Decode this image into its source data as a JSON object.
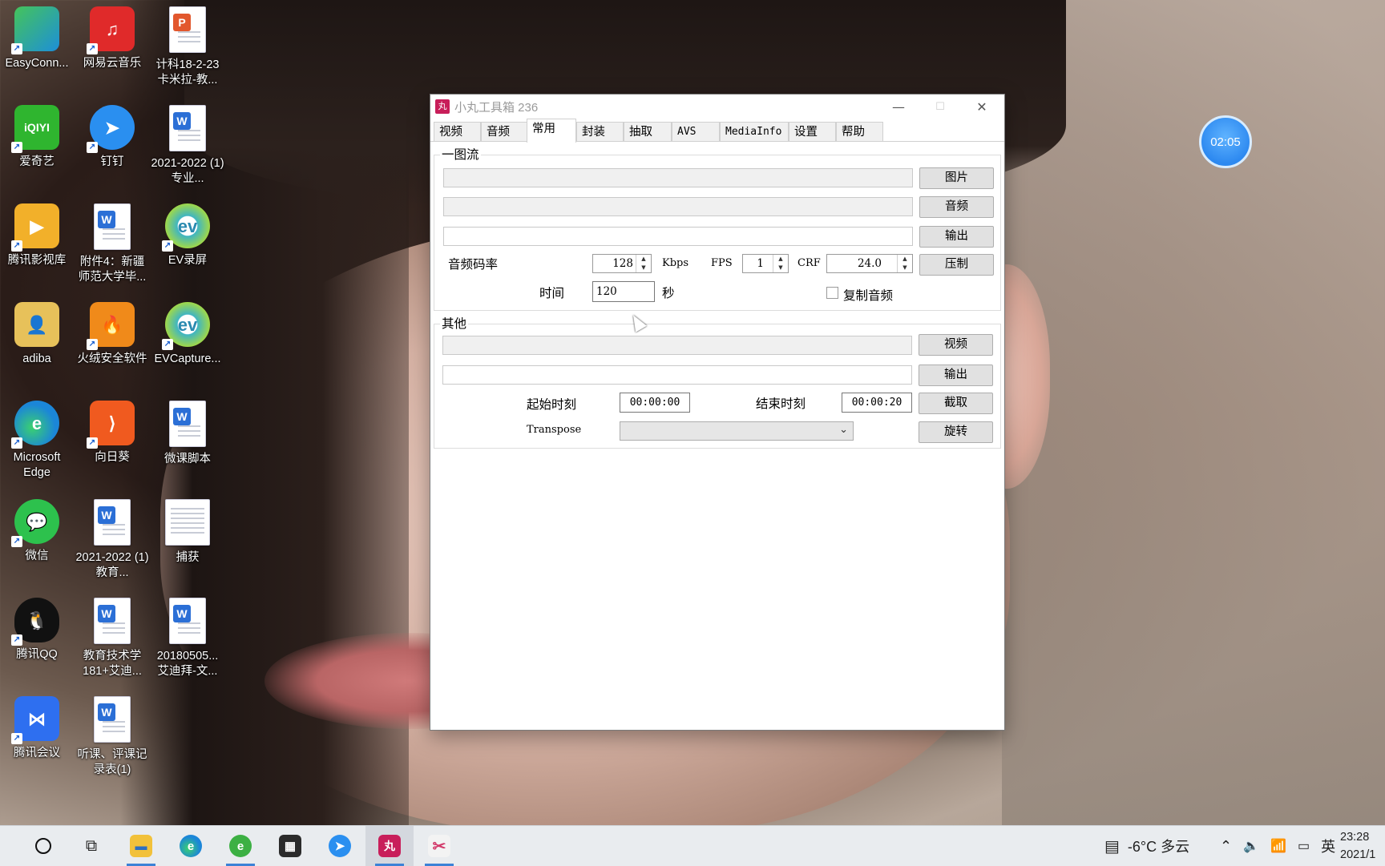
{
  "desktop": {
    "icons": [
      {
        "label": "EasyConn...",
        "color": "#27a0dc"
      },
      {
        "label": "网易云音乐",
        "color": "#e02a2a"
      },
      {
        "label": "计科18-2-23 卡米拉-教...",
        "color": "#ffffff"
      },
      {
        "label": "爱奇艺",
        "color": "#2fb52f"
      },
      {
        "label": "钉钉",
        "color": "#2a8ff0"
      },
      {
        "label": "2021-2022 (1) 专业...",
        "color": "#ffffff"
      },
      {
        "label": "腾讯影视库",
        "color": "#f2b02a"
      },
      {
        "label": "附件4：新疆 师范大学毕...",
        "color": "#ffffff"
      },
      {
        "label": "EV录屏",
        "color": "#3fb5c2"
      },
      {
        "label": "adiba",
        "color": "#e7c15a"
      },
      {
        "label": "火绒安全软件",
        "color": "#f08a1a"
      },
      {
        "label": "EVCapture...",
        "color": "#3fb5c2"
      },
      {
        "label": "Microsoft Edge",
        "color": "#1b86d8"
      },
      {
        "label": "向日葵",
        "color": "#f05a1f"
      },
      {
        "label": "微课脚本",
        "color": "#ffffff"
      },
      {
        "label": "微信",
        "color": "#2dc14d"
      },
      {
        "label": "2021-2022 (1) 教育...",
        "color": "#ffffff"
      },
      {
        "label": "捕获",
        "color": "#ffffff"
      },
      {
        "label": "腾讯QQ",
        "color": "#111111"
      },
      {
        "label": "教育技术学 181+艾迪...",
        "color": "#ffffff"
      },
      {
        "label": "20180505... 艾迪拜-文...",
        "color": "#ffffff"
      },
      {
        "label": "腾讯会议",
        "color": "#2e6ff0"
      },
      {
        "label": "听课、评课记 录表(1)",
        "color": "#ffffff"
      }
    ],
    "clock_widget": "02:05"
  },
  "window": {
    "title": "小丸工具箱 236",
    "app_icon_glyph": "丸",
    "controls": {
      "minimize": "—",
      "maximize": "☐",
      "close": "✕"
    },
    "tabs": [
      "视频",
      "音频",
      "常用",
      "封装",
      "抽取",
      "AVS",
      "MediaInfo",
      "设置",
      "帮助"
    ],
    "active_tab": "常用",
    "group1": {
      "label": "一图流",
      "btn_image": "图片",
      "btn_audio": "音频",
      "btn_output": "输出",
      "btn_compress": "压制",
      "audio_bitrate_label": "音频码率",
      "audio_bitrate": "128",
      "kbps": "Kbps",
      "fps_label": "FPS",
      "fps": "1",
      "crf_label": "CRF",
      "crf": "24.0",
      "time_label": "时间",
      "time_value": "120",
      "seconds": "秒",
      "copy_audio": "复制音频"
    },
    "group2": {
      "label": "其他",
      "btn_video": "视频",
      "btn_output": "输出",
      "start_label": "起始时刻",
      "start_value": "00:00:00",
      "end_label": "结束时刻",
      "end_value": "00:00:20",
      "btn_cut": "截取",
      "transpose_label": "Transpose",
      "btn_rotate": "旋转"
    }
  },
  "taskbar": {
    "weather": "-6°C  多云",
    "ime": "英",
    "time": "23:28",
    "date": "2021/1"
  }
}
